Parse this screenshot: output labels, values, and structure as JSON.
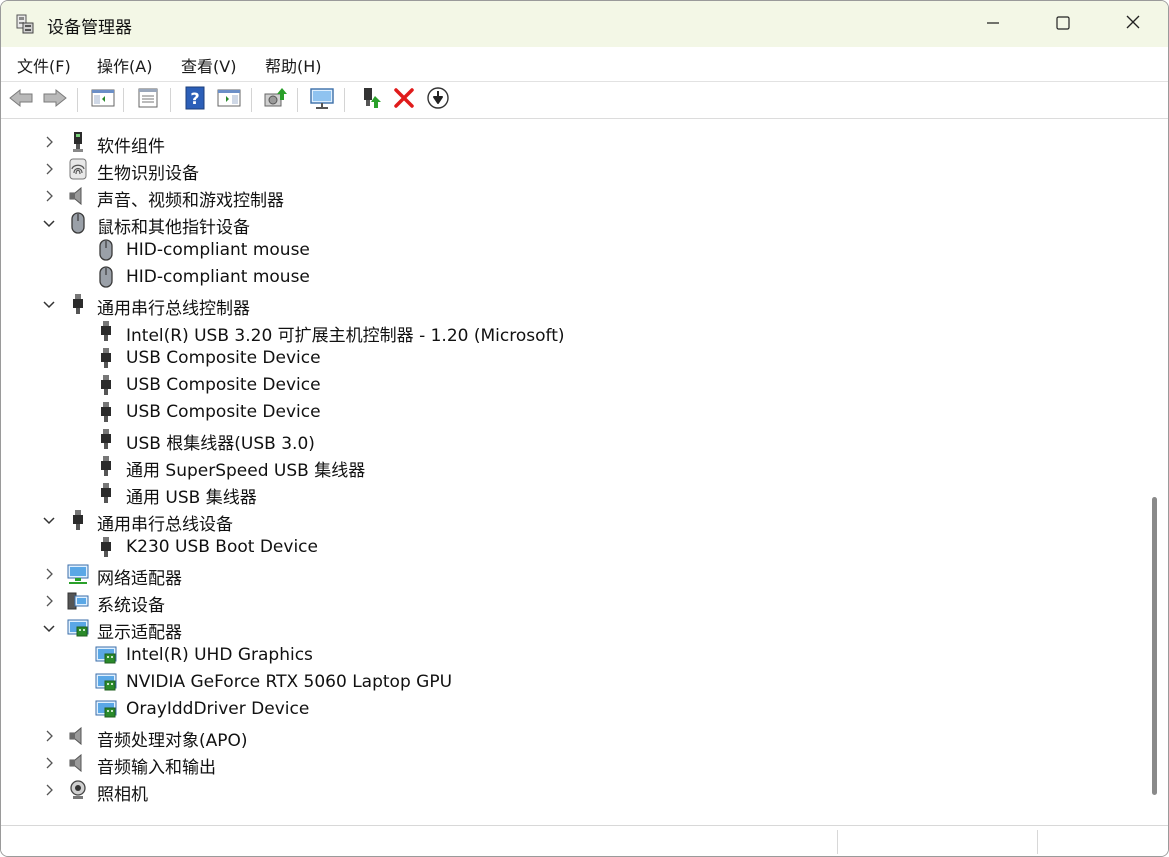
{
  "window": {
    "title": "设备管理器",
    "app_icon": "device-manager-icon",
    "controls": [
      "minimize-icon",
      "maximize-icon",
      "close-icon"
    ]
  },
  "menu": [
    {
      "label": "文件(F)"
    },
    {
      "label": "操作(A)"
    },
    {
      "label": "查看(V)"
    },
    {
      "label": "帮助(H)"
    }
  ],
  "toolbar": [
    {
      "icon": "back-arrow-icon"
    },
    {
      "icon": "forward-arrow-icon"
    },
    {
      "icon": "show-hide-console-tree-icon"
    },
    {
      "icon": "properties-icon"
    },
    {
      "icon": "help-icon"
    },
    {
      "icon": "action-pane-icon"
    },
    {
      "icon": "update-driver-icon"
    },
    {
      "icon": "scan-hardware-icon"
    },
    {
      "icon": "enable-device-icon"
    },
    {
      "icon": "uninstall-device-icon"
    },
    {
      "icon": "disable-device-icon"
    }
  ],
  "tree": [
    {
      "label": "软件组件",
      "level": 0,
      "expanded": false,
      "icon": "software-component-icon"
    },
    {
      "label": "生物识别设备",
      "level": 0,
      "expanded": false,
      "icon": "fingerprint-icon"
    },
    {
      "label": "声音、视频和游戏控制器",
      "level": 0,
      "expanded": false,
      "icon": "speaker-icon"
    },
    {
      "label": "鼠标和其他指针设备",
      "level": 0,
      "expanded": true,
      "icon": "mouse-icon"
    },
    {
      "label": "HID-compliant mouse",
      "level": 1,
      "icon": "mouse-icon"
    },
    {
      "label": "HID-compliant mouse",
      "level": 1,
      "icon": "mouse-icon"
    },
    {
      "label": "通用串行总线控制器",
      "level": 0,
      "expanded": true,
      "icon": "usb-plug-icon"
    },
    {
      "label": "Intel(R) USB 3.20 可扩展主机控制器 - 1.20 (Microsoft)",
      "level": 1,
      "icon": "usb-plug-icon"
    },
    {
      "label": "USB Composite Device",
      "level": 1,
      "icon": "usb-plug-icon"
    },
    {
      "label": "USB Composite Device",
      "level": 1,
      "icon": "usb-plug-icon"
    },
    {
      "label": "USB Composite Device",
      "level": 1,
      "icon": "usb-plug-icon"
    },
    {
      "label": "USB 根集线器(USB 3.0)",
      "level": 1,
      "icon": "usb-plug-icon"
    },
    {
      "label": "通用 SuperSpeed USB 集线器",
      "level": 1,
      "icon": "usb-plug-icon"
    },
    {
      "label": "通用 USB 集线器",
      "level": 1,
      "icon": "usb-plug-icon"
    },
    {
      "label": "通用串行总线设备",
      "level": 0,
      "expanded": true,
      "icon": "usb-plug-icon"
    },
    {
      "label": "K230 USB Boot Device",
      "level": 1,
      "icon": "usb-plug-icon"
    },
    {
      "label": "网络适配器",
      "level": 0,
      "expanded": false,
      "icon": "network-adapter-icon"
    },
    {
      "label": "系统设备",
      "level": 0,
      "expanded": false,
      "icon": "system-device-icon"
    },
    {
      "label": "显示适配器",
      "level": 0,
      "expanded": true,
      "icon": "display-adapter-icon"
    },
    {
      "label": "Intel(R) UHD Graphics",
      "level": 1,
      "icon": "display-adapter-icon"
    },
    {
      "label": "NVIDIA GeForce RTX 5060 Laptop GPU",
      "level": 1,
      "icon": "display-adapter-icon"
    },
    {
      "label": "OrayIddDriver Device",
      "level": 1,
      "icon": "display-adapter-icon"
    },
    {
      "label": "音频处理对象(APO)",
      "level": 0,
      "expanded": false,
      "icon": "speaker-icon"
    },
    {
      "label": "音频输入和输出",
      "level": 0,
      "expanded": false,
      "icon": "speaker-icon"
    },
    {
      "label": "照相机",
      "level": 0,
      "expanded": false,
      "icon": "camera-icon"
    }
  ],
  "colors": {
    "titlebar_bg": "#f3f7e6",
    "uninstall_red": "#e01b1b",
    "help_blue": "#2c5fb8",
    "scroll_thumb": "#8a8a8a"
  }
}
